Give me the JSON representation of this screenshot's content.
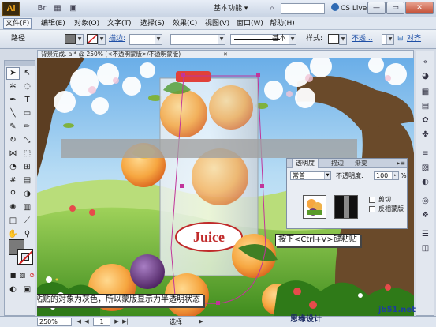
{
  "titlebar": {
    "logo": "Ai",
    "br_label": "Br",
    "workspace": "基本功能",
    "cslive": "CS Live",
    "win_min": "—",
    "win_max": "▭",
    "win_close": "✕"
  },
  "menu": {
    "items": [
      "文件(F)",
      "编辑(E)",
      "对象(O)",
      "文字(T)",
      "选择(S)",
      "效果(C)",
      "视图(V)",
      "窗口(W)",
      "帮助(H)"
    ]
  },
  "control": {
    "selection_label": "路径",
    "stroke_link": "描边:",
    "stroke_style_label": "基本",
    "style_label": "样式:",
    "opacity_link": "不透...",
    "align_icon": "align-icon",
    "more_label": "对齐"
  },
  "doc_tab": {
    "label": "背景完成. ai* @ 250% (<不透明蒙版>/不透明蒙版)",
    "close": "✕"
  },
  "captions": {
    "paste_hint": "按下<Ctrl+V>键粘贴",
    "gray_note": "由于粘贴的对象为灰色，所以蒙版显示为半透明状态"
  },
  "transparency_panel": {
    "tabs": [
      "透明度",
      "描边",
      "渐变"
    ],
    "blend_mode": "常普",
    "opacity_label": "不透明度:",
    "opacity_value": "100",
    "opacity_unit": "%",
    "clip_label": "剪切",
    "invert_label": "反相蒙版",
    "menu": "▸≡"
  },
  "status": {
    "zoom": "250%",
    "page": "1",
    "tool_status": "选择",
    "watermark_1": "jb51.net",
    "watermark_2": "思缘设计"
  },
  "colors": {
    "accent": "#2f6ab3",
    "ai_logo_bg": "#3a2a0e",
    "ai_logo_fg": "#f6a91c",
    "close_btn": "#c34f36",
    "mask_outline": "#c1359a"
  }
}
